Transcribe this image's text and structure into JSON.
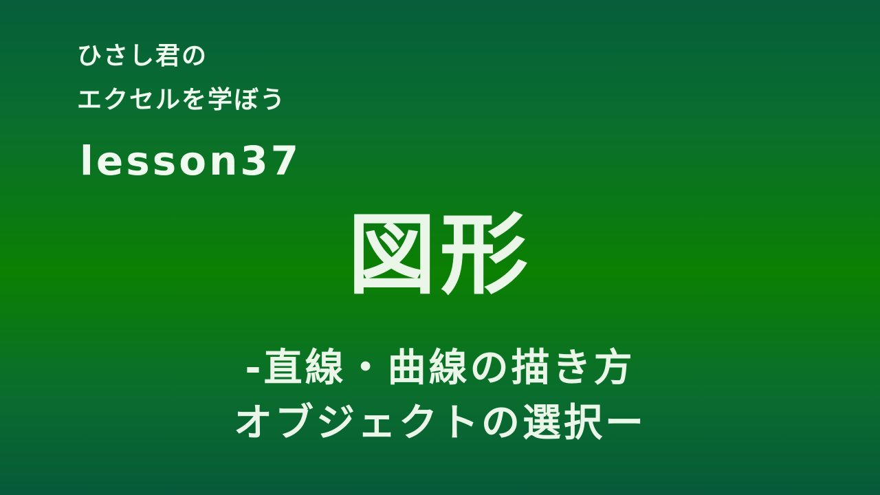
{
  "header": {
    "line1": "ひさし君の",
    "line2": "エクセルを学ぼう",
    "lesson": "lesson37"
  },
  "title": {
    "main": "図形",
    "subtitle_line1": "-直線・曲線の描き方",
    "subtitle_line2": "オブジェクトの選択ー"
  },
  "colors": {
    "background_top": "#065e3a",
    "background_middle": "#0b8002",
    "background_bottom": "#075a3a",
    "text": "#eaf7e8"
  }
}
